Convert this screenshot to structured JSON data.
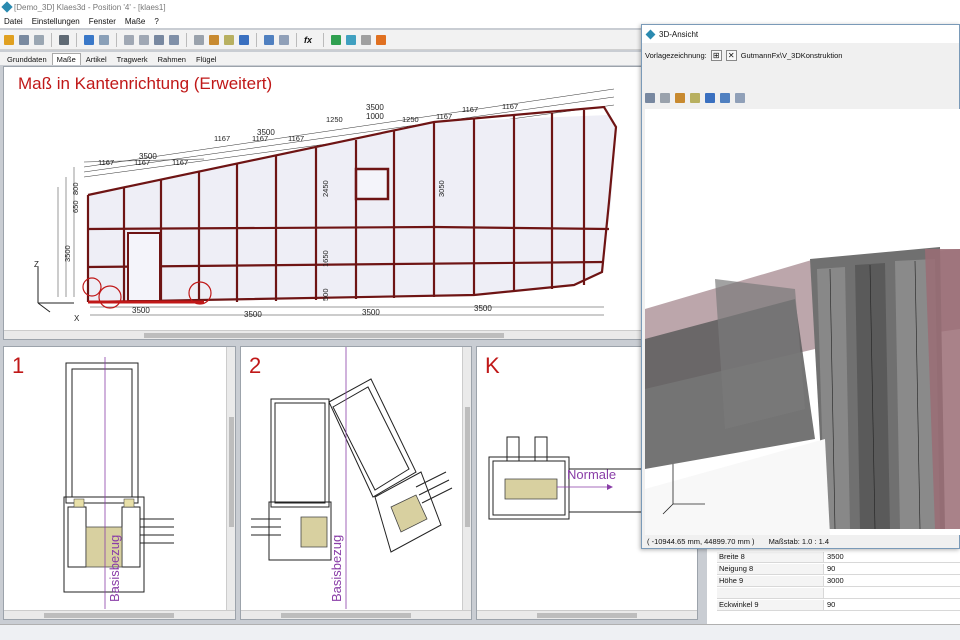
{
  "window": {
    "title": "[Demo_3D] Klaes3d - Position '4' - [klaes1]"
  },
  "menu": [
    "Datei",
    "Einstellungen",
    "Fenster",
    "Maße",
    "?"
  ],
  "tabs": [
    "Grunddaten",
    "Maße",
    "Artikel",
    "Tragwerk",
    "Rahmen",
    "Flügel"
  ],
  "active_tab": "Maße",
  "main_view": {
    "heading": "Maß in Kantenrichtung (Erweitert)",
    "dims_top_row1": [
      "3500",
      "3500",
      "1000",
      "3500"
    ],
    "dims_top_row2": [
      "1167",
      "1167",
      "1167",
      "1167",
      "1167",
      "1167",
      "1167",
      "1250",
      "1250",
      "1167",
      "1167"
    ],
    "dims_left": [
      "3500",
      "650",
      "800",
      "3050",
      "2450",
      "1650",
      "500"
    ],
    "dims_bottom": [
      "3500",
      "3500",
      "3500",
      "3500"
    ],
    "axis_z": "Z",
    "axis_x": "X"
  },
  "section_1": {
    "label": "1",
    "text": "Basisbezug"
  },
  "section_2": {
    "label": "2",
    "text": "Basisbezug"
  },
  "section_k": {
    "label": "K",
    "text": "Normale"
  },
  "view3d": {
    "title": "3D-Ansicht",
    "vorlage_label": "Vorlagezeichnung:",
    "vorlage_value": "GutmannFx\\V_3DKonstruktion",
    "coords": "( -10944.65 mm, 44899.70 mm )",
    "scale": "Maßstab: 1.0 : 1.4"
  },
  "properties": [
    {
      "key": "Breite 8",
      "value": "3500"
    },
    {
      "key": "Neigung 8",
      "value": "90"
    },
    {
      "key": "Höhe 9",
      "value": "3000"
    },
    {
      "key": "",
      "value": ""
    },
    {
      "key": "Eckwinkel 9",
      "value": "90"
    }
  ],
  "colors": {
    "accent_red": "#c01818",
    "frame": "#6e1414",
    "dim": "#2a2a2a"
  }
}
